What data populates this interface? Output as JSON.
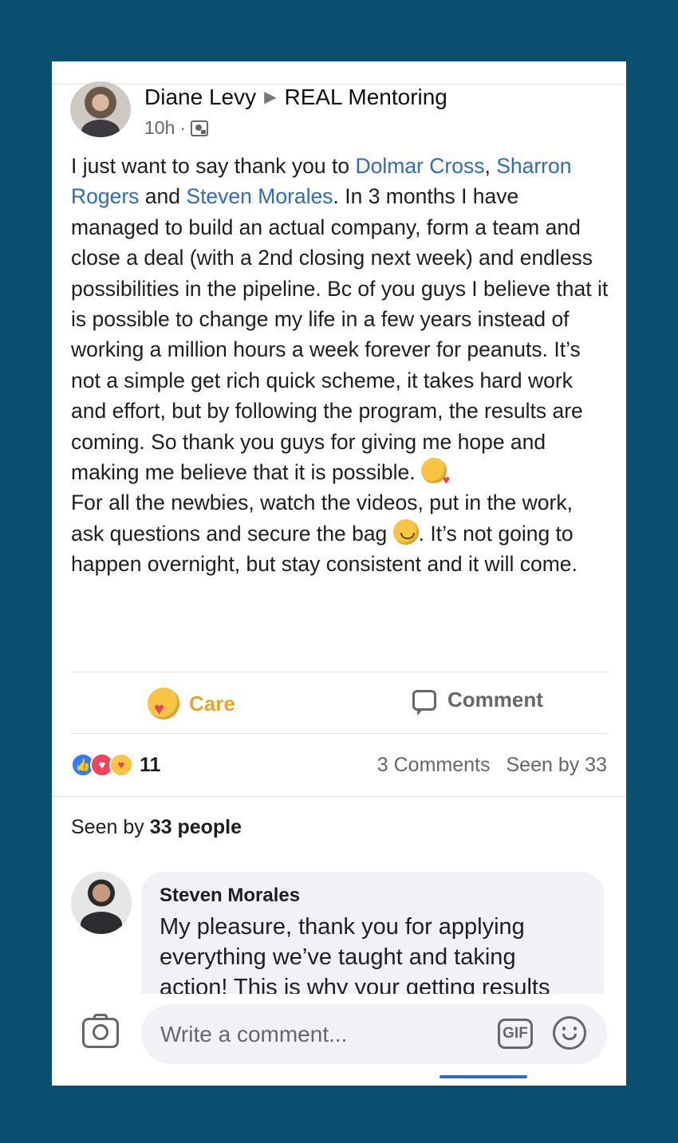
{
  "post": {
    "author": "Diane Levy",
    "group": "REAL Mentoring",
    "time": "10h",
    "separator": "·",
    "body": {
      "p1_prefix": "I just want to say thank you to ",
      "mention1": "Dolmar Cross",
      "p1_comma": ",",
      "mention2": "Sharron Rogers",
      "p1_and": " and ",
      "mention3": "Steven Morales",
      "p1_text": ". In 3 months I have managed to build an actual company, form a team and close a deal (with a 2nd closing next week) and endless possibilities in the pipeline. Bc of you guys I believe that it is possible to change my life in a few years instead of working a million hours a week forever for peanuts. It’s not a simple get rich quick scheme, it takes hard work and effort, but by following the program, the results are coming. So thank you guys for giving me hope and making me believe that it is possible.",
      "p2_text": "For all the newbies, watch the videos, put in the work, ask questions and secure the bag",
      "p2_end": ". It’s not going to happen overnight, but stay consistent and it will come."
    }
  },
  "actions": {
    "care_label": "Care",
    "comment_label": "Comment"
  },
  "stats": {
    "reaction_count": "11",
    "comments": "3 Comments",
    "seen": "Seen by 33"
  },
  "seen_by": {
    "prefix": "Seen by ",
    "count": "33 people"
  },
  "comment": {
    "author": "Steven Morales",
    "text": "My pleasure, thank you for applying everything we’ve taught and taking action! This is why your getting results"
  },
  "composer": {
    "placeholder": "Write a comment...",
    "gif_label": "GIF"
  },
  "colors": {
    "background": "#0a4f70",
    "mention": "#2d6bc4",
    "care": "#e8a52d"
  },
  "icons": [
    "group-privacy-icon",
    "care-reaction-icon",
    "comment-icon",
    "like-reaction-icon",
    "love-reaction-icon",
    "camera-icon",
    "gif-icon",
    "emoji-icon",
    "kiss-emoji-icon",
    "smile-emoji-icon"
  ]
}
